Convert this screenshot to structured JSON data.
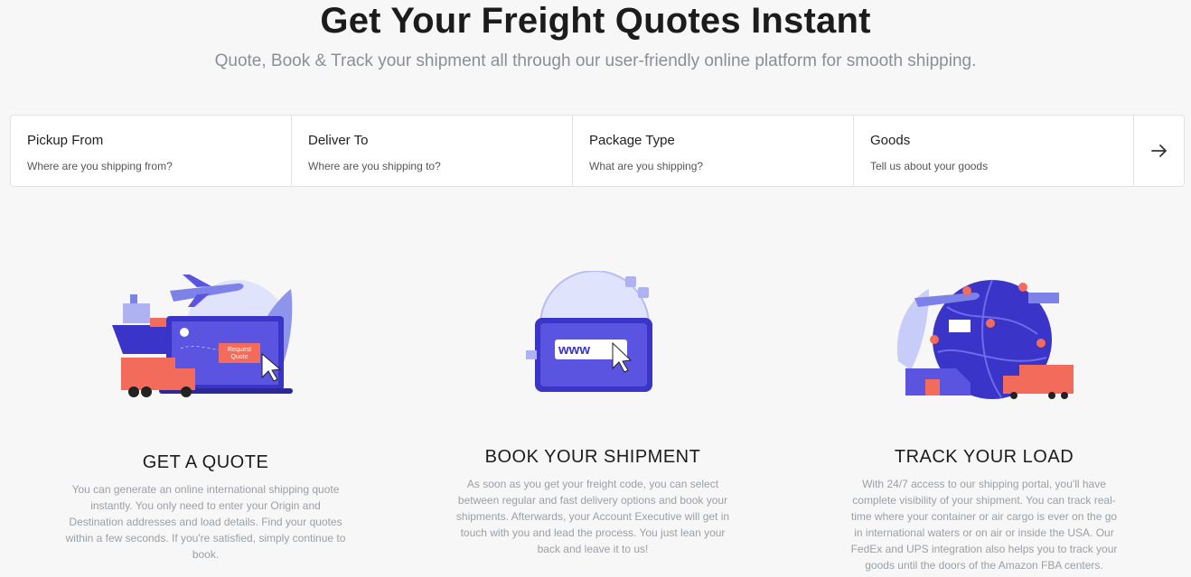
{
  "hero": {
    "title": "Get Your Freight Quotes Instant",
    "subtitle": "Quote, Book & Track your shipment all through our user-friendly online platform for smooth shipping."
  },
  "quote_form": {
    "fields": [
      {
        "label": "Pickup From",
        "placeholder": "Where are you shipping from?"
      },
      {
        "label": "Deliver To",
        "placeholder": "Where are you shipping to?"
      },
      {
        "label": "Package Type",
        "placeholder": "What are you shipping?"
      },
      {
        "label": "Goods",
        "placeholder": "Tell us about your goods"
      }
    ],
    "submit_icon": "arrow-right-icon"
  },
  "features": [
    {
      "title": "GET A QUOTE",
      "text": "You can generate an online international shipping quote instantly. You only need to enter your Origin and Destination addresses and load details. Find your quotes within a few seconds. If you're satisfied, simply continue to book.",
      "illustration": "laptop-quote-illustration",
      "button_text": "Request Quote"
    },
    {
      "title": "BOOK YOUR SHIPMENT",
      "text": "As soon as you get your freight code, you can select between regular and fast delivery options and book your shipments. Afterwards, your Account Executive will get in touch with you and lead the process. You just lean your back and leave it to us!",
      "illustration": "browser-www-illustration",
      "url_text": "www"
    },
    {
      "title": "TRACK YOUR LOAD",
      "text": "With 24/7 access to our shipping portal, you'll have complete visibility of your shipment. You can track real-time where your container or air cargo is ever on the go in international waters or on air or inside the USA. Our FedEx and UPS integration also helps you to track your goods until the doors of the Amazon FBA centers.",
      "illustration": "globe-tracking-illustration"
    }
  ],
  "colors": {
    "accent_purple": "#5b54e0",
    "accent_coral": "#f26b5b",
    "light_blue": "#d7dcfb",
    "muted_text": "#9aa0a6"
  }
}
